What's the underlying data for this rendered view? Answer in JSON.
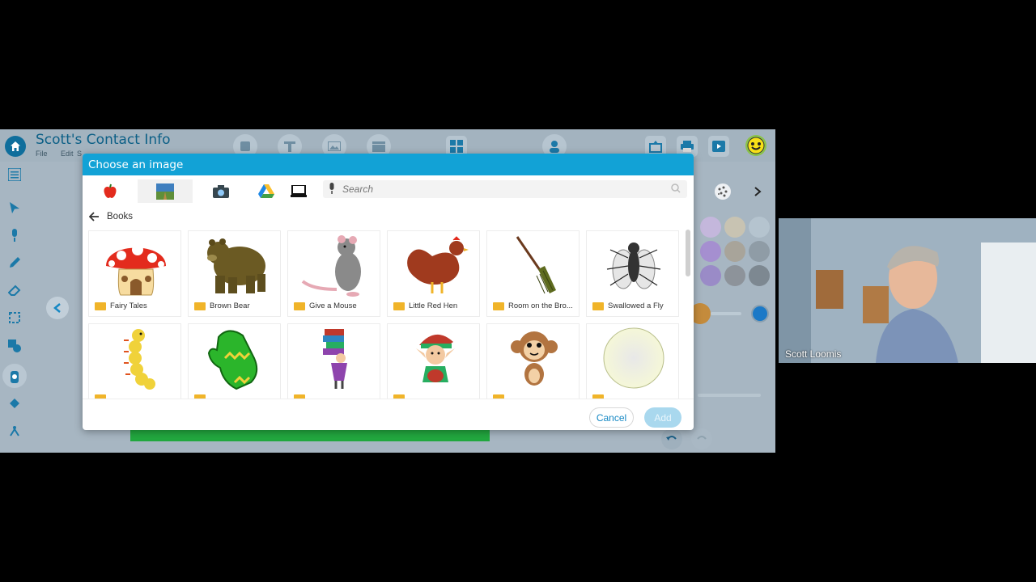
{
  "app": {
    "doc_title": "Scott's Contact Info",
    "menu": [
      "File",
      "Edit",
      "S"
    ]
  },
  "dialog": {
    "title": "Choose an image",
    "source_tabs": [
      "apple-icon",
      "photos-icon",
      "camera-icon",
      "google-drive-icon",
      "computer-icon"
    ],
    "search": {
      "placeholder": "Search",
      "value": ""
    },
    "breadcrumb": "Books",
    "items": [
      {
        "label": "Fairy Tales",
        "icon": "mushroom-house-image"
      },
      {
        "label": "Brown Bear",
        "icon": "bear-image"
      },
      {
        "label": "Give a Mouse",
        "icon": "mouse-image"
      },
      {
        "label": "Little Red Hen",
        "icon": "hen-image"
      },
      {
        "label": "Room on the Bro...",
        "icon": "broom-image"
      },
      {
        "label": "Swallowed a Fly",
        "icon": "fly-image"
      },
      {
        "label": "",
        "icon": "caterpillar-image"
      },
      {
        "label": "",
        "icon": "mitten-image"
      },
      {
        "label": "",
        "icon": "girl-with-books-image"
      },
      {
        "label": "",
        "icon": "elf-image"
      },
      {
        "label": "",
        "icon": "monkey-image"
      },
      {
        "label": "",
        "icon": "circle-image"
      }
    ],
    "cancel_label": "Cancel",
    "add_label": "Add"
  },
  "video": {
    "participant_name": "Scott Loomis"
  },
  "colors": {
    "dialog_header": "#12a2d6",
    "primary_text": "#1588c4",
    "folder": "#f0b429",
    "canvas_bar": "#22a83f"
  }
}
